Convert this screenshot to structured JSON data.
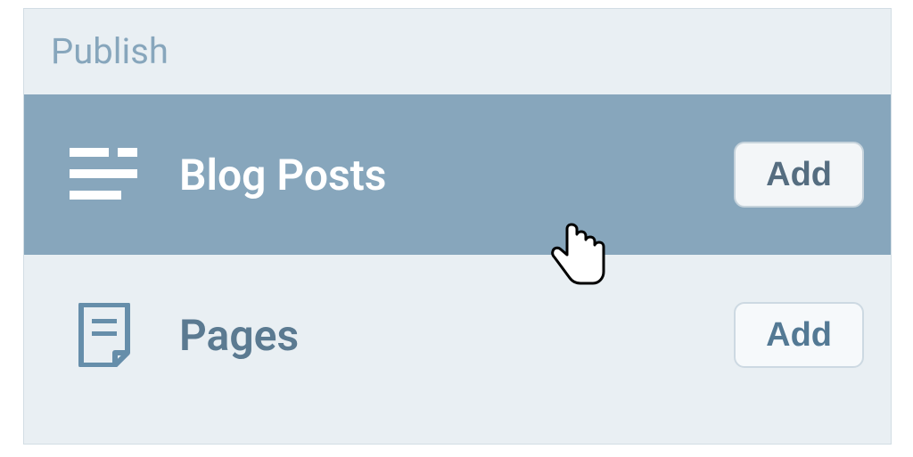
{
  "section": {
    "title": "Publish"
  },
  "items": [
    {
      "label": "Blog Posts",
      "add_label": "Add",
      "icon": "blog-posts-icon",
      "active": true
    },
    {
      "label": "Pages",
      "add_label": "Add",
      "icon": "pages-icon",
      "active": false
    }
  ]
}
